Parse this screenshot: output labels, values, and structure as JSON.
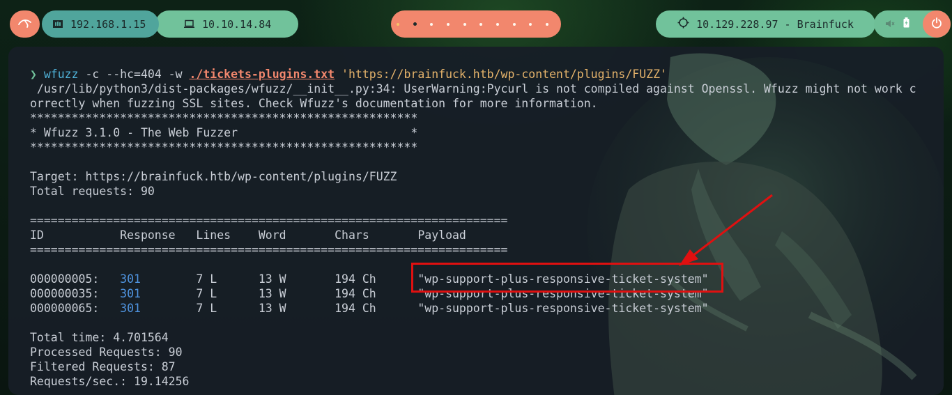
{
  "topbar": {
    "local_ip": "192.168.1.15",
    "vpn_ip": "10.10.14.84",
    "target": "10.129.228.97 - Brainfuck",
    "workspace_count": 10,
    "active_workspace": 2
  },
  "terminal": {
    "prompt_symbol": "❯",
    "command": {
      "bin": "wfuzz",
      "args": " -c --hc=404 -w ",
      "wordlist": "./tickets-plugins.txt",
      "url": " 'https://brainfuck.htb/wp-content/plugins/FUZZ'"
    },
    "warning_1": " /usr/lib/python3/dist-packages/wfuzz/__init__.py:34: UserWarning:Pycurl is not compiled against Openssl. Wfuzz might not work c",
    "warning_2": "orrectly when fuzzing SSL sites. Check Wfuzz's documentation for more information.",
    "banner_border": "********************************************************",
    "banner_title": "* Wfuzz 3.1.0 - The Web Fuzzer                         *",
    "target_line": "Target: https://brainfuck.htb/wp-content/plugins/FUZZ",
    "total_requests": "Total requests: 90",
    "separator": "=====================================================================",
    "header": {
      "id": "ID",
      "response": "Response",
      "lines": "Lines",
      "word": "Word",
      "chars": "Chars",
      "payload": "Payload"
    },
    "rows": [
      {
        "id": "000000005:",
        "response": "301",
        "lines": "7 L",
        "word": "13 W",
        "chars": "194 Ch",
        "payload": "\"wp-support-plus-responsive-ticket-system\""
      },
      {
        "id": "000000035:",
        "response": "301",
        "lines": "7 L",
        "word": "13 W",
        "chars": "194 Ch",
        "payload": "\"wp-support-plus-responsive-ticket-system\""
      },
      {
        "id": "000000065:",
        "response": "301",
        "lines": "7 L",
        "word": "13 W",
        "chars": "194 Ch",
        "payload": "\"wp-support-plus-responsive-ticket-system\""
      }
    ],
    "summary": {
      "total_time": "Total time: 4.701564",
      "processed": "Processed Requests: 90",
      "filtered": "Filtered Requests: 87",
      "rate": "Requests/sec.: 19.14256"
    }
  },
  "colors": {
    "accent_green": "#71c29b",
    "accent_salmon": "#f2876d",
    "highlight_red": "#e01010"
  }
}
